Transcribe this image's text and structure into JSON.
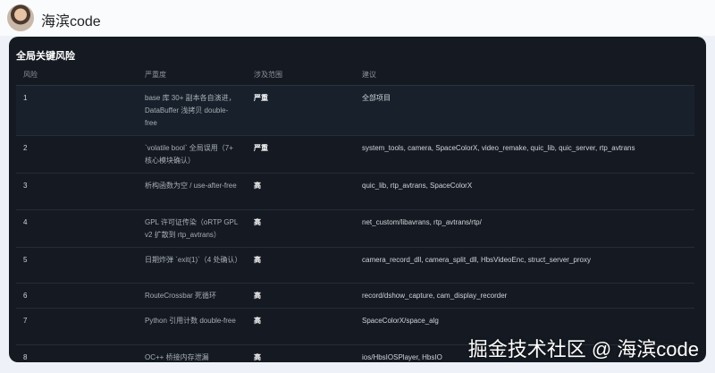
{
  "header": {
    "username": "海滨code"
  },
  "card": {
    "title": "全局关键风险",
    "columns": [
      "风险",
      "严重度",
      "涉及范围",
      "建议"
    ],
    "rows": [
      {
        "id": "1",
        "risk": "base 库 30+ 副本各自演进，DataBuffer 浅拷贝 double-free",
        "severity": "严重",
        "scope": "全部项目"
      },
      {
        "id": "2",
        "risk": "`volatile bool` 全局误用（7+ 核心模块确认）",
        "severity": "严重",
        "scope": "system_tools, camera, SpaceColorX, video_remake, quic_lib, quic_server, rtp_avtrans"
      },
      {
        "id": "3",
        "risk": "析构函数为空 / use-after-free",
        "severity": "高",
        "scope": "quic_lib, rtp_avtrans, SpaceColorX"
      },
      {
        "id": "4",
        "risk": "GPL 许可证传染（oRTP GPL v2 扩散到 rtp_avtrans）",
        "severity": "高",
        "scope": "net_custom/libavrans, rtp_avtrans/rtp/"
      },
      {
        "id": "5",
        "risk": "日期炸弹 `exit(1)`（4 处确认）",
        "severity": "高",
        "scope": "camera_record_dll, camera_split_dll, HbsVideoEnc, struct_server_proxy"
      },
      {
        "id": "6",
        "risk": "RouteCrossbar 死循环",
        "severity": "高",
        "scope": "record/dshow_capture, cam_display_recorder"
      },
      {
        "id": "7",
        "risk": "Python 引用计数 double-free",
        "severity": "高",
        "scope": "SpaceColorX/space_alg"
      },
      {
        "id": "8",
        "risk": "OC++ 桥接内存泄漏",
        "severity": "高",
        "scope": "ios/HbsIOSPlayer, HbsIO"
      }
    ]
  },
  "watermark": "掘金技术社区 @ 海滨code"
}
